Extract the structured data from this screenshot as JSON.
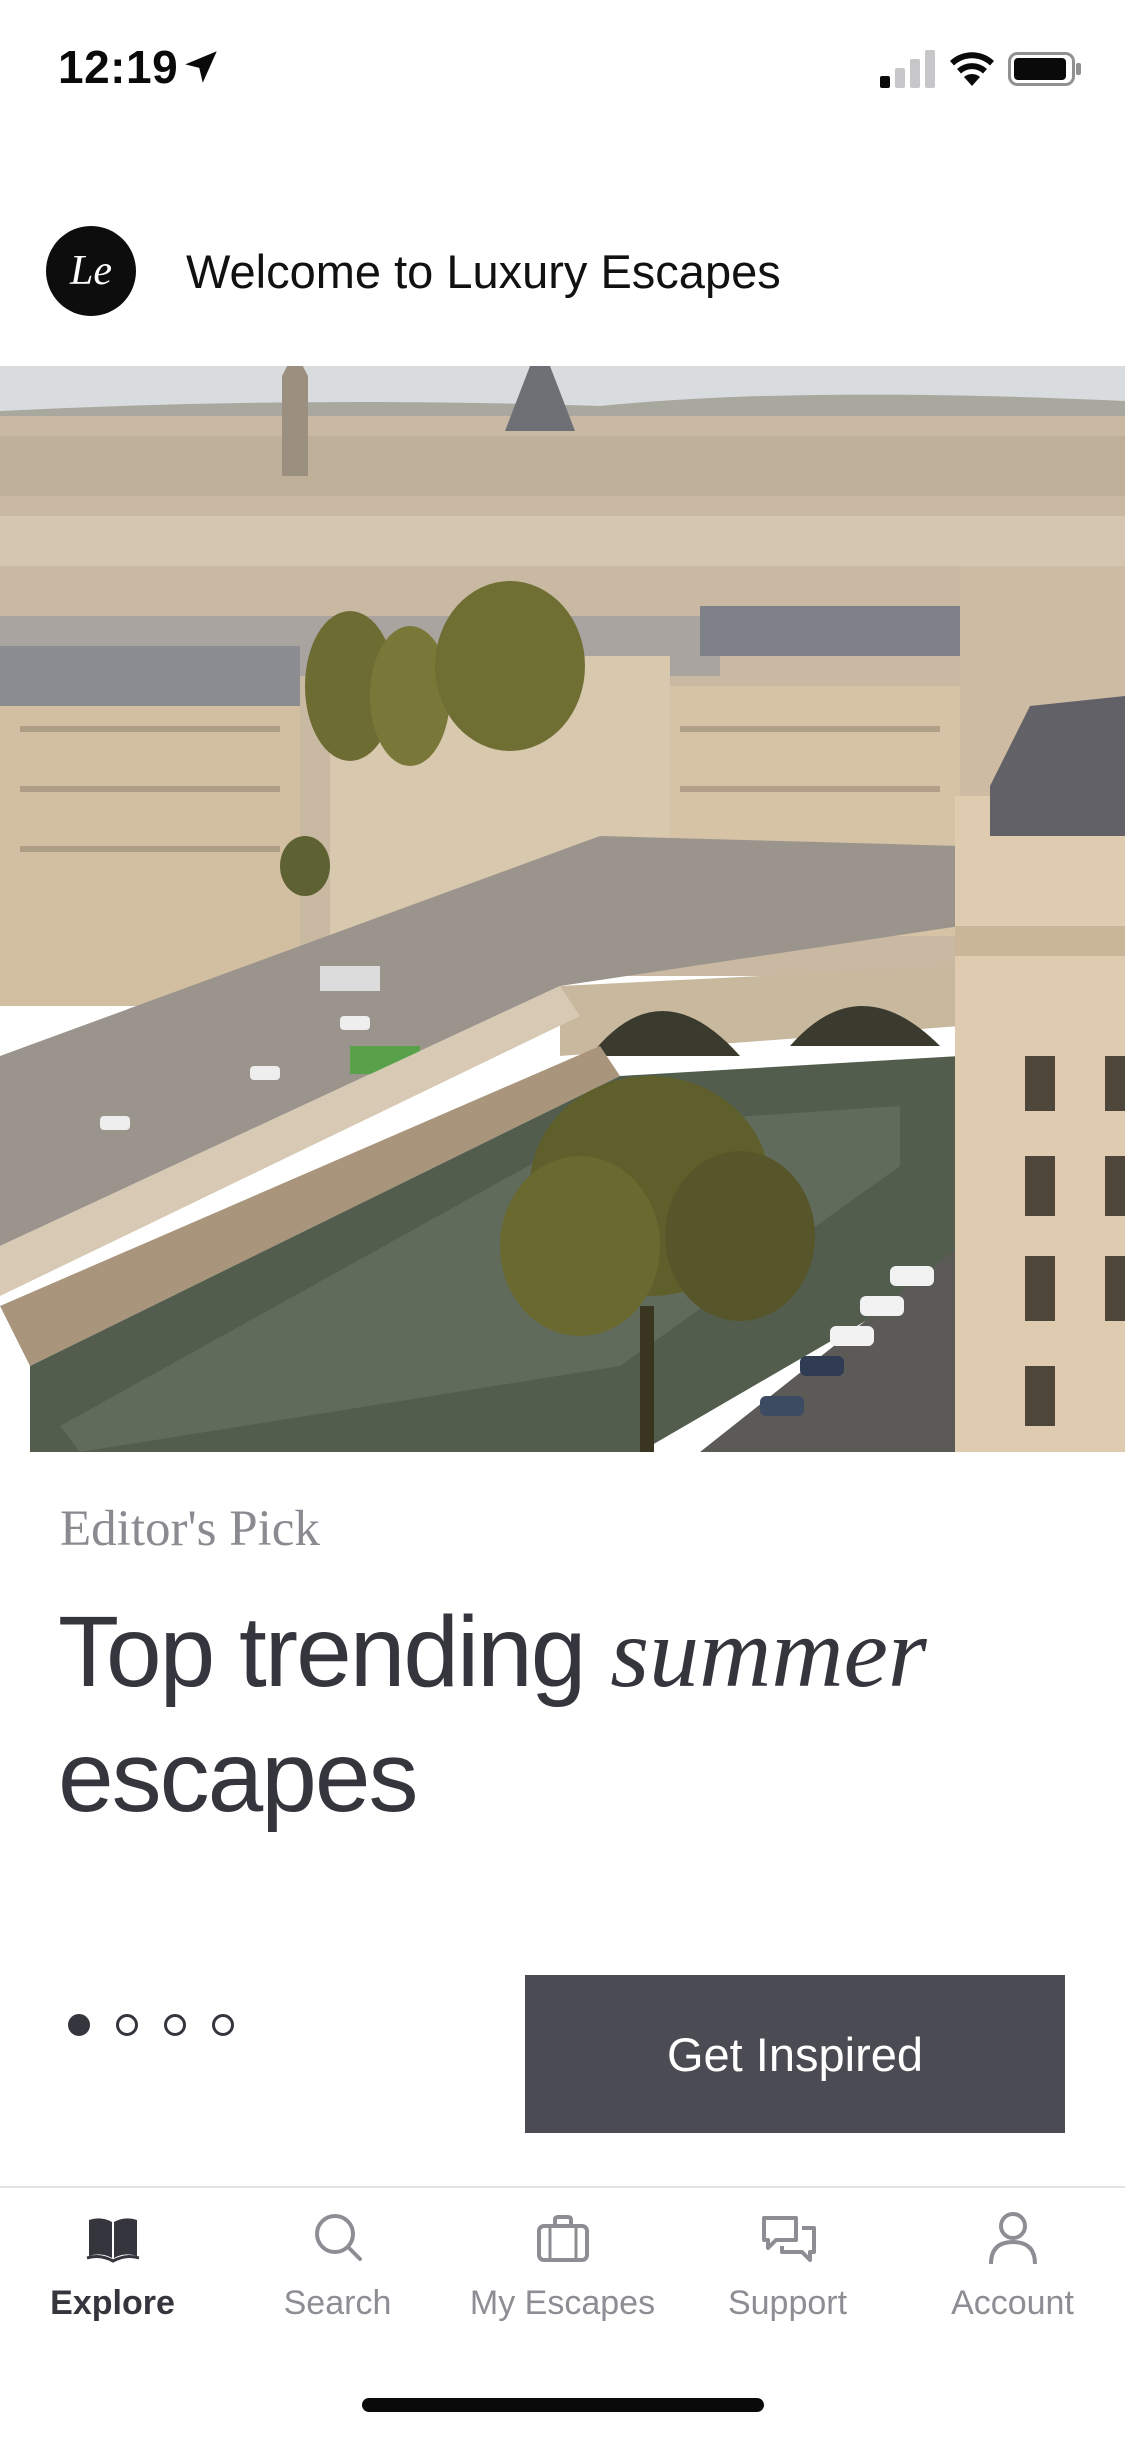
{
  "status_bar": {
    "time": "12:19"
  },
  "header": {
    "title": "Welcome to Luxury Escapes",
    "logo_text": "Le"
  },
  "hero": {
    "icon": "paris-cityscape-photo"
  },
  "feature": {
    "kicker": "Editor's Pick",
    "headline_part1": "Top trending ",
    "headline_italic": "summer",
    "headline_part2": "escapes",
    "cta_label": "Get Inspired",
    "pager": {
      "total": 4,
      "active": 1
    }
  },
  "tabs": [
    {
      "label": "Explore",
      "icon": "book-icon",
      "active": true
    },
    {
      "label": "Search",
      "icon": "search-icon",
      "active": false
    },
    {
      "label": "My Escapes",
      "icon": "briefcase-icon",
      "active": false
    },
    {
      "label": "Support",
      "icon": "chat-icon",
      "active": false
    },
    {
      "label": "Account",
      "icon": "person-icon",
      "active": false
    }
  ],
  "colors": {
    "text": "#35363d",
    "cta_bg": "#4b4c53",
    "muted": "#8d8e93"
  }
}
